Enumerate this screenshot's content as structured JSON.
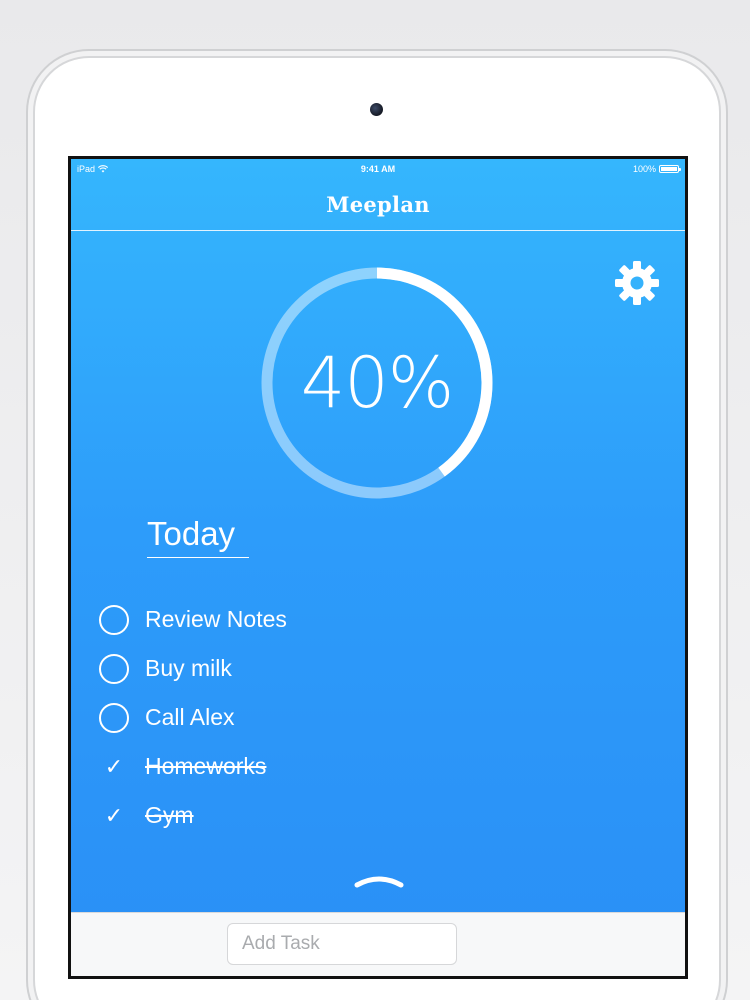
{
  "status_bar": {
    "carrier": "iPad",
    "time": "9:41 AM",
    "battery": "100%"
  },
  "app": {
    "title": "Meeplan",
    "settings_icon": "gear-icon"
  },
  "progress": {
    "label": "40%",
    "value": 0.4
  },
  "section": {
    "title": "Today"
  },
  "tasks": [
    {
      "label": "Review Notes",
      "done": false
    },
    {
      "label": "Buy milk",
      "done": false
    },
    {
      "label": "Call Alex",
      "done": false
    },
    {
      "label": "Homeworks",
      "done": true
    },
    {
      "label": "Gym",
      "done": true
    }
  ],
  "bottom_bar": {
    "add_task_placeholder": "Add Task"
  },
  "colors": {
    "background_top": "#35b6fd",
    "background_bottom": "#2a8ff6",
    "foreground": "#ffffff"
  }
}
